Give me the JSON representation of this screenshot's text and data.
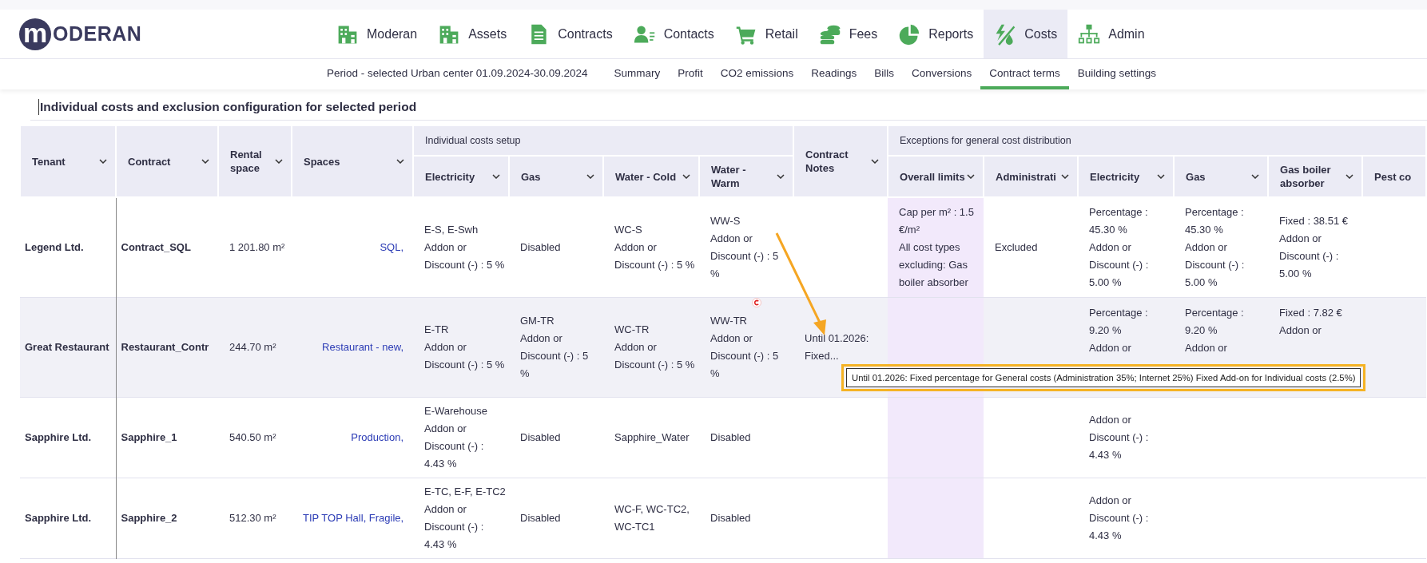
{
  "logo": {
    "mark": "m",
    "text": "ODERAN"
  },
  "nav": [
    {
      "label": "Moderan",
      "selected": false
    },
    {
      "label": "Assets",
      "selected": false
    },
    {
      "label": "Contracts",
      "selected": false
    },
    {
      "label": "Contacts",
      "selected": false
    },
    {
      "label": "Retail",
      "selected": false
    },
    {
      "label": "Fees",
      "selected": false
    },
    {
      "label": "Reports",
      "selected": false
    },
    {
      "label": "Costs",
      "selected": true
    },
    {
      "label": "Admin",
      "selected": false
    }
  ],
  "period": "Period - selected Urban center 01.09.2024-30.09.2024",
  "subnav": [
    {
      "label": "Summary",
      "selected": false
    },
    {
      "label": "Profit",
      "selected": false
    },
    {
      "label": "CO2 emissions",
      "selected": false
    },
    {
      "label": "Readings",
      "selected": false
    },
    {
      "label": "Bills",
      "selected": false
    },
    {
      "label": "Conversions",
      "selected": false
    },
    {
      "label": "Contract terms",
      "selected": true
    },
    {
      "label": "Building settings",
      "selected": false
    }
  ],
  "section_title": "Individual costs and exclusion configuration for selected period",
  "table": {
    "columns": [
      {
        "label": "Tenant",
        "dropdown": true,
        "kind": "name"
      },
      {
        "label": "Contract",
        "dropdown": true,
        "kind": "name"
      },
      {
        "label": "Rental space",
        "dropdown": true,
        "kind": "number"
      },
      {
        "label": "Spaces",
        "dropdown": true,
        "kind": "link"
      },
      {
        "label": "Individual costs setup",
        "children": [
          {
            "label": "Electricity",
            "dropdown": true,
            "kind": "text"
          },
          {
            "label": "Gas",
            "dropdown": true,
            "kind": "text"
          },
          {
            "label": "Water - Cold",
            "dropdown": true,
            "kind": "text"
          },
          {
            "label": "Water - Warm",
            "dropdown": true,
            "kind": "text"
          }
        ]
      },
      {
        "label": "Contract Notes",
        "dropdown": true,
        "kind": "text"
      },
      {
        "label": "Exceptions for general cost distribution",
        "children": [
          {
            "label": "Overall limits",
            "dropdown": true,
            "kind": "limit"
          },
          {
            "label": "Administrati",
            "dropdown": true,
            "kind": "text"
          },
          {
            "label": "Electricity",
            "dropdown": true,
            "kind": "text"
          },
          {
            "label": "Gas",
            "dropdown": true,
            "kind": "text"
          },
          {
            "label": "Gas boiler absorber",
            "dropdown": true,
            "kind": "text"
          },
          {
            "label": "Pest co",
            "dropdown": false,
            "kind": "text"
          }
        ]
      }
    ],
    "rows": [
      {
        "highlighted": false,
        "cells": [
          "Legend Ltd.",
          "Contract_SQL",
          "1 201.80 m²",
          "SQL,",
          [
            "E-S, E-Swh\nAddon or Discount (-) : 5 %",
            "Disabled",
            "WC-S\nAddon or Discount (-) : 5 %",
            "WW-S\nAddon or Discount (-) : 5 %"
          ],
          null,
          [
            "Cap per m² : 1.5 €/m²\nAll cost types excluding: Gas boiler absorber",
            "Excluded",
            "Percentage : 45.30 %\nAddon or Discount (-) : 5.00 %",
            "Percentage : 45.30 %\nAddon or Discount (-) : 5.00 %",
            "Fixed : 38.51 €\nAddon or Discount (-) : 5.00 %",
            null
          ]
        ]
      },
      {
        "highlighted": true,
        "cells": [
          "Great Restaurant",
          "Restaurant_Contr",
          "244.70 m²",
          "Restaurant - new,",
          [
            "E-TR\nAddon or Discount (-) : 5 %",
            "GM-TR\nAddon or Discount (-) : 5 %",
            "WC-TR\nAddon or Discount (-) : 5 %",
            "WW-TR\nAddon or Discount (-) : 5 %"
          ],
          "Until 01.2026: Fixed...",
          [
            null,
            null,
            "Percentage : 9.20 %\nAddon or",
            "Percentage : 9.20 %\nAddon or",
            "Fixed : 7.82 €\nAddon or",
            null
          ]
        ]
      },
      {
        "highlighted": false,
        "cells": [
          "Sapphire Ltd.",
          "Sapphire_1",
          "540.50 m²",
          "Production,",
          [
            "E-Warehouse\nAddon or Discount (-) : 4.43 %",
            "Disabled",
            "Sapphire_Water",
            "Disabled"
          ],
          null,
          [
            null,
            null,
            "Addon or Discount (-) : 4.43 %",
            null,
            null,
            null
          ]
        ]
      },
      {
        "highlighted": false,
        "cells": [
          "Sapphire Ltd.",
          "Sapphire_2",
          "512.30 m²",
          "TIP TOP Hall, Fragile,",
          [
            "E-TC, E-F, E-TC2\nAddon or Discount (-) : 4.43 %",
            "Disabled",
            "WC-F, WC-TC2, WC-TC1",
            "Disabled"
          ],
          null,
          [
            null,
            null,
            "Addon or Discount (-) : 4.43 %",
            null,
            null,
            null
          ]
        ]
      }
    ]
  },
  "tooltip": "Until 01.2026: Fixed percentage for General costs (Administration 35%; Internet 25%) Fixed Add-on for Individual costs (2.5%)"
}
